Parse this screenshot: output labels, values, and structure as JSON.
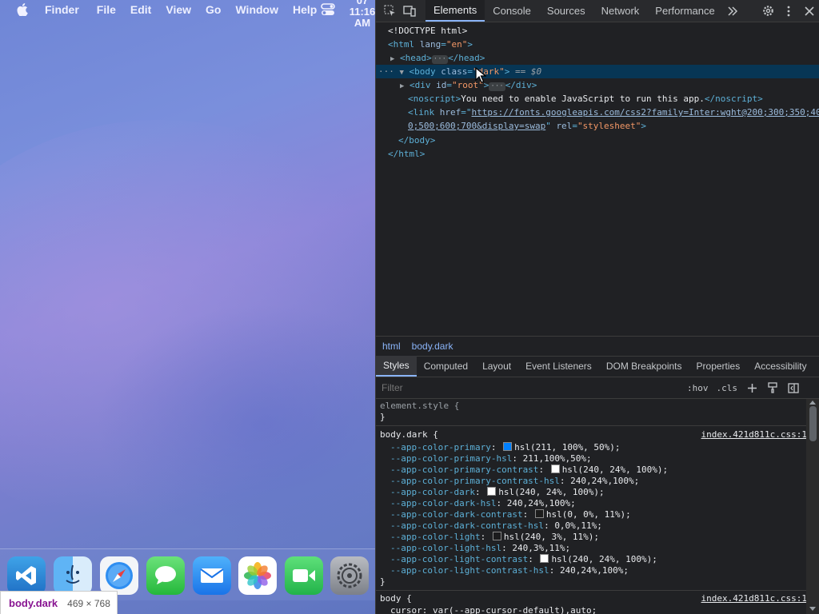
{
  "menubar": {
    "app": "Finder",
    "items": [
      "File",
      "Edit",
      "View",
      "Go",
      "Window",
      "Help"
    ],
    "clock": [
      "07",
      "11:16",
      "AM"
    ]
  },
  "dock": {
    "apps": [
      "vscode-icon",
      "finder-icon",
      "safari-icon",
      "messages-icon",
      "mail-icon",
      "photos-icon",
      "facetime-icon",
      "system-preferences-icon"
    ]
  },
  "dimension_tooltip": {
    "selector": "body.dark",
    "size": "469 × 768"
  },
  "devtools": {
    "tabs": [
      "Elements",
      "Console",
      "Sources",
      "Network",
      "Performance"
    ],
    "active_tab": "Elements",
    "dom": {
      "doctype": "<!DOCTYPE html>",
      "html_open": "<html",
      "lang_attr": "lang",
      "lang_val": "\"en\"",
      "head": "<head>",
      "head_close": "</head>",
      "body_open": "<body",
      "class_attr": "class",
      "class_val": "\"dark\"",
      "eq": "== $0",
      "div_open": "<div",
      "id_attr": "id",
      "id_val": "\"root\"",
      "div_close": "</div>",
      "noscript_open": "<noscript>",
      "noscript_text": "You need to enable JavaScript to run this app.",
      "noscript_close": "</noscript>",
      "link_open": "<link",
      "href_attr": "href",
      "href_line1": "https://fonts.googleapis.com/css2?family=Inter:wght@200;300;350;40",
      "href_line2": "0;500;600;700&display=swap",
      "rel_attr": "rel",
      "rel_val": "\"stylesheet\"",
      "body_close": "</body>",
      "html_close": "</html>"
    },
    "breadcrumbs": [
      "html",
      "body.dark"
    ],
    "subtabs": [
      "Styles",
      "Computed",
      "Layout",
      "Event Listeners",
      "DOM Breakpoints",
      "Properties",
      "Accessibility"
    ],
    "active_subtab": "Styles",
    "filter_placeholder": "Filter",
    "hov": ":hov",
    "cls": ".cls",
    "styles": {
      "element_style": "element.style {",
      "close": "}",
      "rule1_selector": "body.dark {",
      "rule1_source": "index.421d811c.css:1",
      "rule1_props": [
        {
          "name": "--app-color-primary",
          "value": "hsl(211, 100%, 50%);",
          "swatch": "#0080ff"
        },
        {
          "name": "--app-color-primary-hsl",
          "value": "211,100%,50%;",
          "swatch": ""
        },
        {
          "name": "--app-color-primary-contrast",
          "value": "hsl(240, 24%, 100%);",
          "swatch": "#ffffff"
        },
        {
          "name": "--app-color-primary-contrast-hsl",
          "value": "240,24%,100%;",
          "swatch": ""
        },
        {
          "name": "--app-color-dark",
          "value": "hsl(240, 24%, 100%);",
          "swatch": "#ffffff"
        },
        {
          "name": "--app-color-dark-hsl",
          "value": "240,24%,100%;",
          "swatch": ""
        },
        {
          "name": "--app-color-dark-contrast",
          "value": "hsl(0, 0%, 11%);",
          "swatch": "#1c1c1c"
        },
        {
          "name": "--app-color-dark-contrast-hsl",
          "value": "0,0%,11%;",
          "swatch": ""
        },
        {
          "name": "--app-color-light",
          "value": "hsl(240, 3%, 11%);",
          "swatch": "#1b1b1d"
        },
        {
          "name": "--app-color-light-hsl",
          "value": "240,3%,11%;",
          "swatch": ""
        },
        {
          "name": "--app-color-light-contrast",
          "value": "hsl(240, 24%, 100%);",
          "swatch": "#ffffff"
        },
        {
          "name": "--app-color-light-contrast-hsl",
          "value": "240,24%,100%;",
          "swatch": ""
        }
      ],
      "rule2_selector": "body {",
      "rule2_source": "index.421d811c.css:1",
      "rule2_first": "cursor: var(--app-cursor-default),auto;"
    }
  }
}
